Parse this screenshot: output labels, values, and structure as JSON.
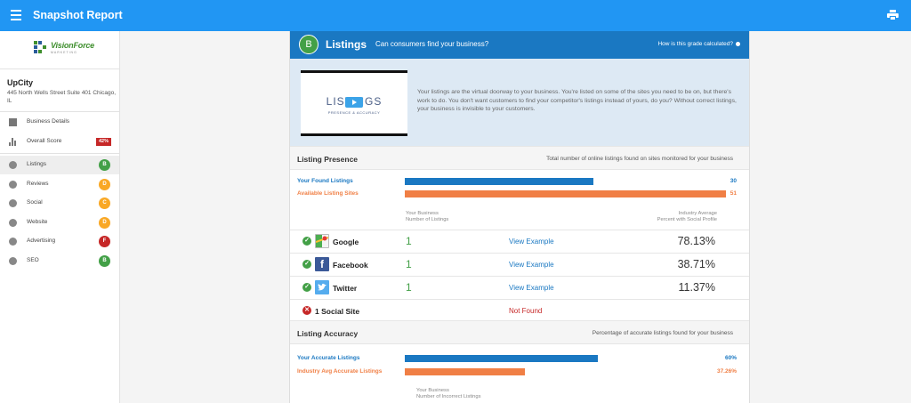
{
  "header": {
    "title": "Snapshot Report"
  },
  "sidebar": {
    "logo": {
      "main": "VisionForce",
      "sub": "MARKETING"
    },
    "company": "UpCity",
    "address": "445 North Wells Street Suite 401 Chicago, IL",
    "items": [
      {
        "label": "Business Details",
        "icon": "building-icon"
      },
      {
        "label": "Overall Score",
        "icon": "bar-chart-icon",
        "badge": "42%"
      },
      {
        "label": "Listings",
        "icon": "pin-icon",
        "grade": "B",
        "color": "#43a047"
      },
      {
        "label": "Reviews",
        "icon": "star-icon",
        "grade": "D",
        "color": "#f9a825"
      },
      {
        "label": "Social",
        "icon": "chat-icon",
        "grade": "C",
        "color": "#f9a825"
      },
      {
        "label": "Website",
        "icon": "monitor-icon",
        "grade": "D",
        "color": "#f9a825"
      },
      {
        "label": "Advertising",
        "icon": "megaphone-icon",
        "grade": "F",
        "color": "#c62828"
      },
      {
        "label": "SEO",
        "icon": "magnifier-icon",
        "grade": "B",
        "color": "#43a047"
      }
    ]
  },
  "panel": {
    "grade": "B",
    "title": "Listings",
    "question": "Can consumers find your business?",
    "calc_link": "How is this grade calculated?",
    "video": {
      "title": "LISTINGS",
      "subtitle": "PRESENCE & ACCURACY"
    },
    "intro_text": "Your listings are the virtual doorway to your business. You're listed on some of the sites you need to be on, but there's work to do. You don't want customers to find your competitor's listings instead of yours, do you? Without correct listings, your business is invisible to your customers."
  },
  "presence": {
    "title": "Listing Presence",
    "desc": "Total number of online listings found on sites monitored for your business",
    "bars": [
      {
        "label": "Your Found Listings",
        "value": "30",
        "fraction": 0.588,
        "color": "#1a78c2"
      },
      {
        "label": "Available Listing Sites",
        "value": "51",
        "fraction": 1.0,
        "color": "#f07f45"
      }
    ],
    "col_left": [
      "Your Business",
      "Number of Listings"
    ],
    "col_right": [
      "Industry Average",
      "Percent with Social Profile"
    ],
    "sites": [
      {
        "name": "Google",
        "count": "1",
        "link": "View Example",
        "pct": "78.13%",
        "status": "found"
      },
      {
        "name": "Facebook",
        "count": "1",
        "link": "View Example",
        "pct": "38.71%",
        "status": "found"
      },
      {
        "name": "Twitter",
        "count": "1",
        "link": "View Example",
        "pct": "11.37%",
        "status": "found"
      }
    ],
    "missing": {
      "name": "1 Social Site",
      "status_text": "Not Found"
    }
  },
  "accuracy": {
    "title": "Listing Accuracy",
    "desc": "Percentage of accurate listings found for your business",
    "bars": [
      {
        "label": "Your Accurate Listings",
        "value": "60%",
        "fraction": 0.6,
        "color": "#1a78c2"
      },
      {
        "label": "Industry Avg Accurate Listings",
        "value": "37.26%",
        "fraction": 0.3726,
        "color": "#f07f45"
      }
    ],
    "col_left": [
      "Your Business",
      "Number of Incorrect Listings"
    ]
  },
  "colors": {
    "topbar": "#2196f3",
    "panel_header": "#1a78c2",
    "green": "#43a047",
    "red": "#c62828"
  }
}
